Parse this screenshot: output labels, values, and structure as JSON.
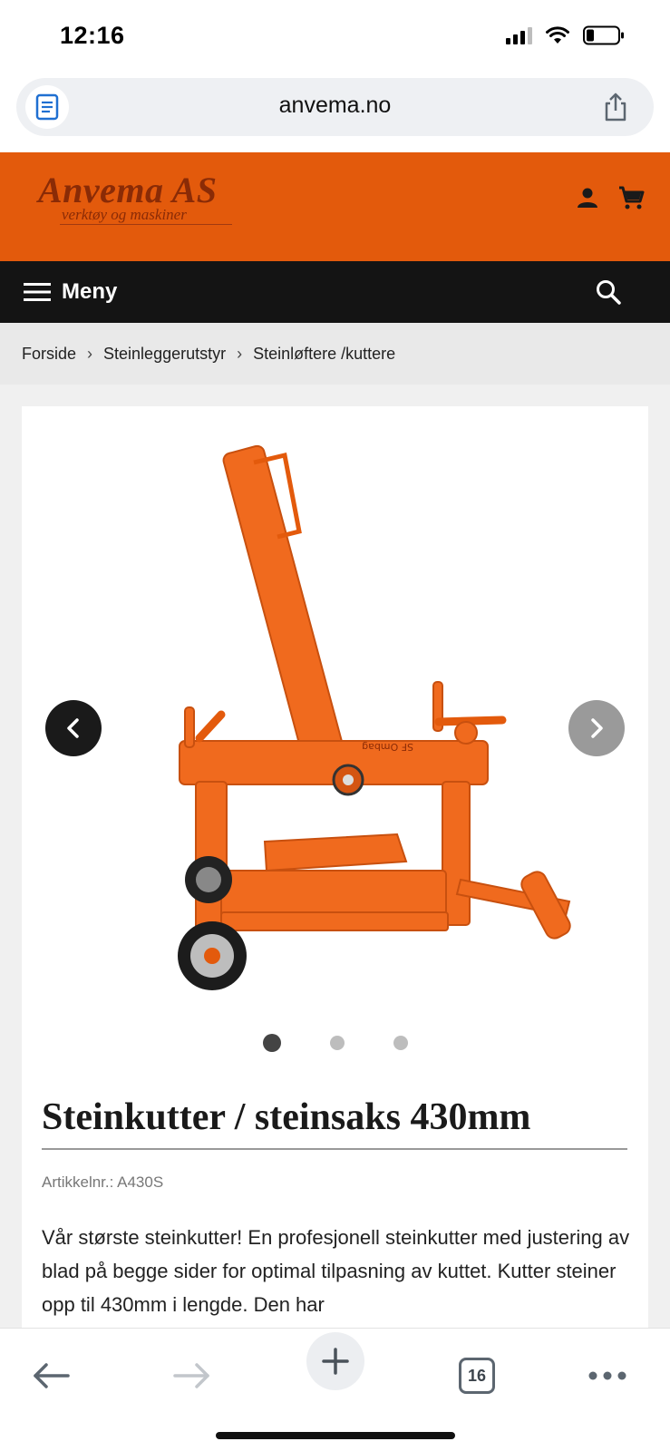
{
  "status_bar": {
    "time": "12:16",
    "icons": [
      "cellular-signal-icon",
      "wifi-icon",
      "battery-icon"
    ]
  },
  "browser": {
    "url": "anvema.no",
    "reader_icon": "reader-icon",
    "share_icon": "share-icon"
  },
  "header": {
    "logo_main": "Anvema AS",
    "logo_sub": "verktøy og maskiner",
    "icons": [
      "account-icon",
      "cart-icon"
    ]
  },
  "nav": {
    "menu_label": "Meny",
    "search_icon": "search-icon"
  },
  "breadcrumb": {
    "items": [
      "Forside",
      "Steinleggerutstyr",
      "Steinløftere /kuttere"
    ]
  },
  "product": {
    "image_alt": "orange stone cutter",
    "title": "Steinkutter / steinsaks 430mm",
    "sku": "Artikkelnr.: A430S",
    "description": "Vår største steinkutter! En profesjonell steinkutter med justering av blad på begge sider for optimal tilpasning av kuttet. Kutter steiner opp til 430mm i lengde. Den har",
    "gallery_index": 1,
    "gallery_total": 3
  },
  "toolbar": {
    "tab_count": "16",
    "icons": [
      "back-arrow-icon",
      "forward-arrow-icon",
      "plus-icon",
      "tabs-icon",
      "more-icon"
    ]
  },
  "colors": {
    "brand_orange": "#e35a0c",
    "nav_black": "#141414",
    "logo_brown": "#8a2b06"
  }
}
